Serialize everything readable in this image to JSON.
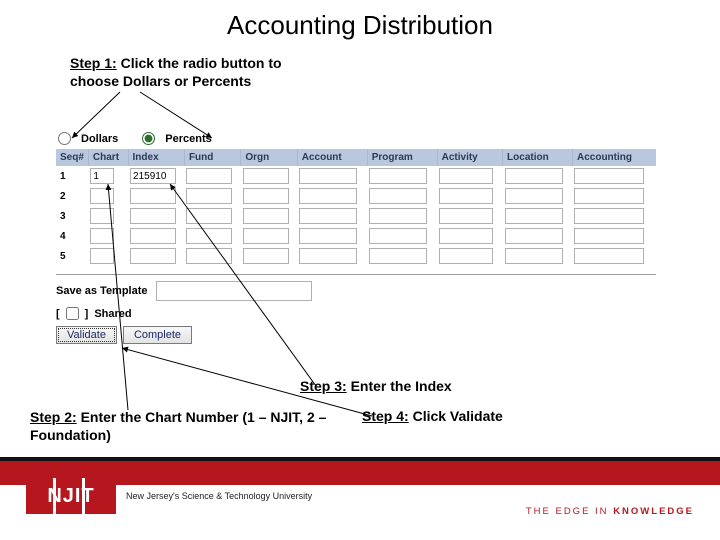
{
  "title": "Accounting Distribution",
  "steps": {
    "s1_label": "Step 1:",
    "s1_text": " Click the radio button to choose Dollars or Percents",
    "s2_label": "Step 2:",
    "s2_text": " Enter the Chart Number (1 – NJIT, 2 – Foundation)",
    "s3_label": "Step 3:",
    "s3_text": " Enter the Index",
    "s4_label": "Step 4:",
    "s4_text": " Click Validate"
  },
  "radio": {
    "dollars": "Dollars",
    "percents": "Percents",
    "selected": "percents"
  },
  "headers": [
    "Seq#",
    "Chart",
    "Index",
    "Fund",
    "Orgn",
    "Account",
    "Program",
    "Activity",
    "Location",
    "Accounting"
  ],
  "rows": [
    {
      "seq": "1",
      "chart": "1",
      "index": "215910",
      "fund": "",
      "orgn": "",
      "account": "",
      "program": "",
      "activity": "",
      "location": "",
      "accounting": ""
    },
    {
      "seq": "2",
      "chart": "",
      "index": "",
      "fund": "",
      "orgn": "",
      "account": "",
      "program": "",
      "activity": "",
      "location": "",
      "accounting": ""
    },
    {
      "seq": "3",
      "chart": "",
      "index": "",
      "fund": "",
      "orgn": "",
      "account": "",
      "program": "",
      "activity": "",
      "location": "",
      "accounting": ""
    },
    {
      "seq": "4",
      "chart": "",
      "index": "",
      "fund": "",
      "orgn": "",
      "account": "",
      "program": "",
      "activity": "",
      "location": "",
      "accounting": ""
    },
    {
      "seq": "5",
      "chart": "",
      "index": "",
      "fund": "",
      "orgn": "",
      "account": "",
      "program": "",
      "activity": "",
      "location": "",
      "accounting": ""
    }
  ],
  "template": {
    "label": "Save as Template",
    "value": ""
  },
  "shared": {
    "label": "Shared",
    "checked": false
  },
  "buttons": {
    "validate": "Validate",
    "complete": "Complete"
  },
  "footer": {
    "njit": "NJIT",
    "tagline": "New Jersey's Science & Technology University",
    "edge1": "THE EDGE IN ",
    "edge2": "KNOWLEDGE"
  }
}
